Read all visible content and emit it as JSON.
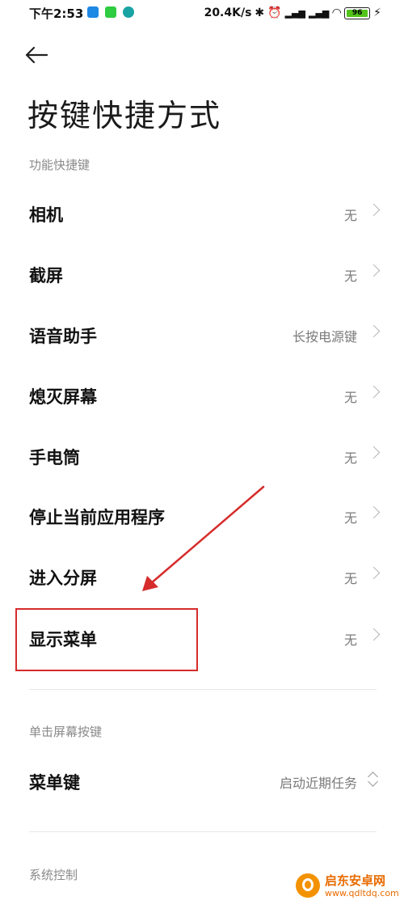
{
  "status_bar": {
    "time": "下午2:53",
    "network_speed": "20.4K/s",
    "battery": "96",
    "icons": [
      "bluetooth-icon",
      "alarm-icon",
      "hd-signal-icon",
      "hd-signal-icon",
      "wifi-icon",
      "battery-icon",
      "charging-icon"
    ],
    "app_icon_colors": [
      "#1e88e5",
      "#2ecc40",
      "#1aa3a3"
    ]
  },
  "header": {
    "back_icon": "back-arrow-icon",
    "title": "按键快捷方式"
  },
  "section_function": {
    "label": "功能快捷键",
    "items": [
      {
        "title": "相机",
        "value": "无"
      },
      {
        "title": "截屏",
        "value": "无"
      },
      {
        "title": "语音助手",
        "value": "长按电源键"
      },
      {
        "title": "熄灭屏幕",
        "value": "无"
      },
      {
        "title": "手电筒",
        "value": "无"
      },
      {
        "title": "停止当前应用程序",
        "value": "无"
      },
      {
        "title": "进入分屏",
        "value": "无"
      },
      {
        "title": "显示菜单",
        "value": "无"
      }
    ]
  },
  "section_single_click": {
    "label": "单击屏幕按键",
    "items": [
      {
        "title": "菜单键",
        "value": "启动近期任务"
      }
    ]
  },
  "section_system": {
    "label": "系统控制"
  },
  "annotation": {
    "color": "#d62b2b"
  },
  "watermark": {
    "line1": "启东安卓网",
    "line2": "www.qdltdq.com"
  }
}
